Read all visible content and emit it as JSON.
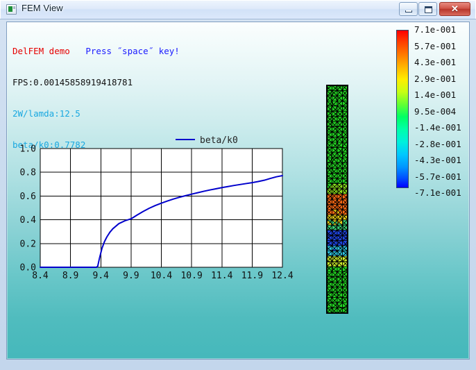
{
  "window": {
    "title": "FEM View",
    "icon": "app-window-icon",
    "buttons": {
      "minimize": "minimize-button",
      "maximize": "maximize-button",
      "close_glyph": "✕"
    }
  },
  "hud": {
    "line1_a": "DelFEM demo",
    "line1_gap": "   ",
    "line1_b": "Press ˝space˝ key!",
    "line2": "FPS:0.00145858919418781",
    "line3": "2W/lamda:12.5",
    "line4": "beta/k0:0.7782",
    "colors": {
      "red": "#e60000",
      "blue": "#1a1aff",
      "black": "#111111",
      "cyan": "#19a8e0"
    }
  },
  "chart_data": {
    "type": "line",
    "title": "",
    "xlabel": "",
    "ylabel": "",
    "xlim": [
      8.4,
      12.4
    ],
    "ylim": [
      0.0,
      1.0
    ],
    "grid": true,
    "legend_position": "top-right",
    "legend": [
      "beta/k0"
    ],
    "line_color": "#0000cc",
    "xticks": [
      "8.4",
      "8.9",
      "9.4",
      "9.9",
      "10.4",
      "10.9",
      "11.4",
      "11.9",
      "12.4"
    ],
    "yticks": [
      "0.0",
      "0.2",
      "0.4",
      "0.6",
      "0.8",
      "1.0"
    ],
    "series": [
      {
        "name": "beta/k0",
        "x": [
          8.4,
          8.6,
          8.8,
          9.0,
          9.2,
          9.33,
          9.35,
          9.38,
          9.42,
          9.46,
          9.5,
          9.55,
          9.6,
          9.7,
          9.8,
          9.9,
          10.0,
          10.1,
          10.2,
          10.3,
          10.4,
          10.5,
          10.6,
          10.7,
          10.8,
          10.9,
          11.0,
          11.1,
          11.2,
          11.3,
          11.4,
          11.5,
          11.6,
          11.7,
          11.8,
          11.9,
          12.0,
          12.1,
          12.2,
          12.3,
          12.4
        ],
        "y": [
          0.0,
          0.0,
          0.0,
          0.0,
          0.0,
          0.0,
          0.01,
          0.08,
          0.16,
          0.215,
          0.255,
          0.295,
          0.325,
          0.368,
          0.392,
          0.408,
          0.44,
          0.47,
          0.497,
          0.52,
          0.54,
          0.558,
          0.575,
          0.59,
          0.603,
          0.616,
          0.628,
          0.64,
          0.651,
          0.661,
          0.671,
          0.68,
          0.689,
          0.697,
          0.705,
          0.713,
          0.722,
          0.733,
          0.748,
          0.762,
          0.772
        ]
      }
    ]
  },
  "colorbar": {
    "name": "field-value-colorbar",
    "gradient": [
      "#ff0000",
      "#ffff00",
      "#00ff00",
      "#00ffff",
      "#0000ff"
    ],
    "labels": [
      "7.1e-001",
      "5.7e-001",
      "4.3e-001",
      "2.9e-001",
      "1.4e-001",
      "9.5e-004",
      "-1.4e-001",
      "-2.8e-001",
      "-4.3e-001",
      "-5.7e-001",
      "-7.1e-001"
    ]
  },
  "mesh": {
    "name": "fem-mesh-waveguide",
    "outline_color": "#000000",
    "bands": [
      {
        "from": 0.0,
        "to": 0.44,
        "color": "#23d723"
      },
      {
        "from": 0.44,
        "to": 0.48,
        "color": "#8ee61e"
      },
      {
        "from": 0.48,
        "to": 0.56,
        "color": "#ff6a14"
      },
      {
        "from": 0.56,
        "to": 0.6,
        "color": "#e8d018"
      },
      {
        "from": 0.6,
        "to": 0.64,
        "color": "#3ad77a"
      },
      {
        "from": 0.64,
        "to": 0.71,
        "color": "#1f46e6"
      },
      {
        "from": 0.71,
        "to": 0.75,
        "color": "#2ec8e6"
      },
      {
        "from": 0.75,
        "to": 0.8,
        "color": "#cdee2a"
      },
      {
        "from": 0.8,
        "to": 1.0,
        "color": "#23d723"
      }
    ]
  }
}
